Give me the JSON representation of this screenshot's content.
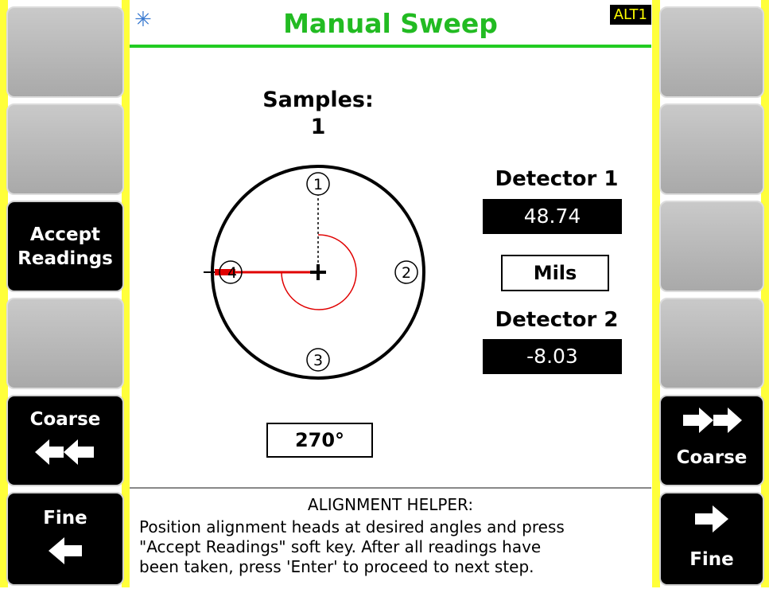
{
  "header": {
    "title": "Manual Sweep",
    "mode_badge": "ALT1",
    "logo_icon": "laser-star-icon"
  },
  "samples": {
    "label": "Samples:",
    "count": "1"
  },
  "detector1": {
    "label": "Detector 1",
    "value": "48.74"
  },
  "units": "Mils",
  "detector2": {
    "label": "Detector 2",
    "value": "-8.03"
  },
  "angle": "270°",
  "positions": [
    "1",
    "2",
    "3",
    "4"
  ],
  "softkeys_left": [
    {
      "label": ""
    },
    {
      "label": ""
    },
    {
      "label": "Accept\nReadings"
    },
    {
      "label": ""
    },
    {
      "label": "Coarse",
      "icon": "double-left-arrow-icon"
    },
    {
      "label": "Fine",
      "icon": "left-arrow-icon"
    }
  ],
  "softkeys_right": [
    {
      "label": ""
    },
    {
      "label": ""
    },
    {
      "label": ""
    },
    {
      "label": ""
    },
    {
      "label": "Coarse",
      "icon": "double-right-arrow-icon"
    },
    {
      "label": "Fine",
      "icon": "right-arrow-icon"
    }
  ],
  "helper": {
    "title": "ALIGNMENT HELPER:",
    "line1": "Position alignment heads at desired angles and press",
    "line2": "\"Accept Readings\" soft key. After all readings have",
    "line3": "been taken, press 'Enter' to proceed to next step."
  },
  "colors": {
    "title": "#22bb22",
    "rail": "#ffff3a",
    "indicator": "#e00000"
  }
}
